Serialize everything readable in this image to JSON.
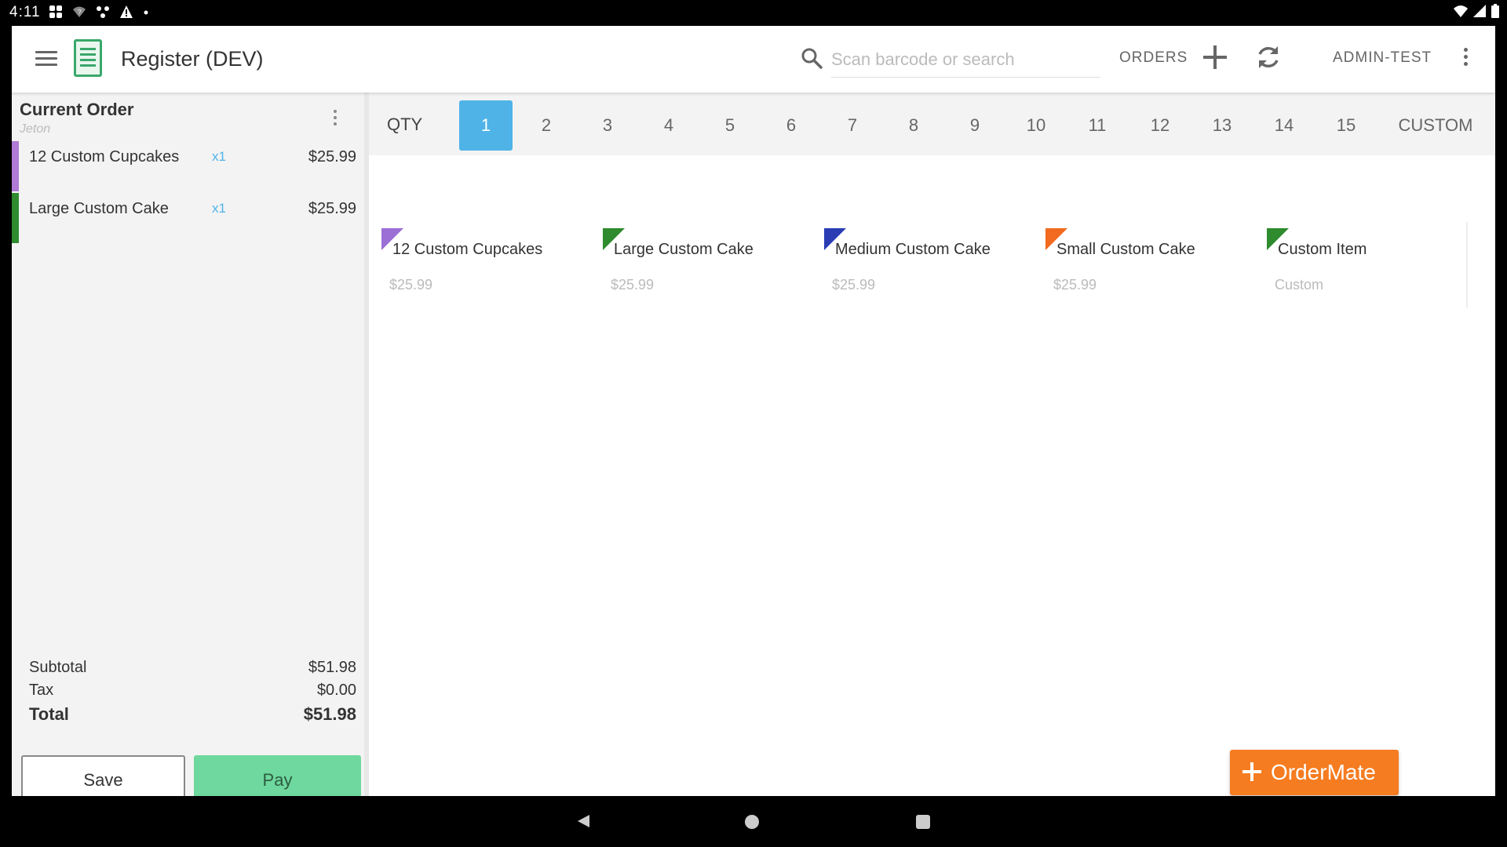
{
  "status_bar": {
    "time": "4:11",
    "icons_left": [
      "app-notification-icon",
      "wifi-question-icon",
      "network-icon",
      "warning-icon",
      "dot-icon"
    ],
    "icons_right": [
      "wifi-icon",
      "signal-icon",
      "battery-icon"
    ]
  },
  "toolbar": {
    "title": "Register (DEV)",
    "search_placeholder": "Scan barcode or search",
    "orders_label": "ORDERS",
    "user_label": "ADMIN-TEST"
  },
  "order": {
    "title": "Current Order",
    "subtitle": "Jeton",
    "items": [
      {
        "name": "12 Custom Cupcakes",
        "qty": "x1",
        "price": "$25.99",
        "color": "#b07ad6"
      },
      {
        "name": "Large Custom Cake",
        "qty": "x1",
        "price": "$25.99",
        "color": "#2e8b2e"
      }
    ],
    "subtotal_label": "Subtotal",
    "subtotal": "$51.98",
    "tax_label": "Tax",
    "tax": "$0.00",
    "total_label": "Total",
    "total": "$51.98",
    "save_label": "Save",
    "pay_label": "Pay"
  },
  "quantity": {
    "label": "QTY",
    "options": [
      "1",
      "2",
      "3",
      "4",
      "5",
      "6",
      "7",
      "8",
      "9",
      "10",
      "11",
      "12",
      "13",
      "14",
      "15",
      "CUSTOM"
    ],
    "selected": "1"
  },
  "products": [
    {
      "name": "12 Custom Cupcakes",
      "price": "$25.99",
      "color": "#9b6fd6"
    },
    {
      "name": "Large Custom Cake",
      "price": "$25.99",
      "color": "#2e8b2e"
    },
    {
      "name": "Medium Custom Cake",
      "price": "$25.99",
      "color": "#2a3db5"
    },
    {
      "name": "Small Custom Cake",
      "price": "$25.99",
      "color": "#f26a1f"
    },
    {
      "name": "Custom Item",
      "price": "Custom",
      "color": "#2e8b2e"
    }
  ],
  "ordermate_label": "OrderMate",
  "colors": {
    "accent": "#4fb3e8",
    "pay": "#6ed89e",
    "ordermate": "#f57c20"
  }
}
